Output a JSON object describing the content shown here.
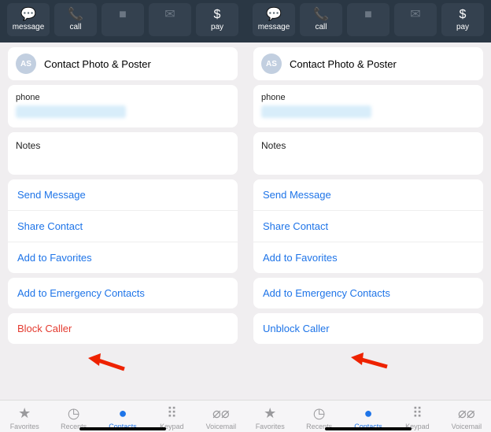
{
  "topbar": {
    "message": "message",
    "call": "call",
    "video": "video",
    "mail": "mail",
    "pay": "pay"
  },
  "contact_photo": {
    "initials": "AS",
    "label": "Contact Photo & Poster"
  },
  "phone": {
    "label": "phone"
  },
  "notes": {
    "label": "Notes"
  },
  "actions": {
    "send_message": "Send Message",
    "share_contact": "Share Contact",
    "add_favorites": "Add to Favorites",
    "add_emergency": "Add to Emergency Contacts",
    "block": "Block Caller",
    "unblock": "Unblock Caller"
  },
  "tabs": {
    "favorites": "Favorites",
    "recents": "Recents",
    "contacts": "Contacts",
    "keypad": "Keypad",
    "voicemail": "Voicemail"
  }
}
